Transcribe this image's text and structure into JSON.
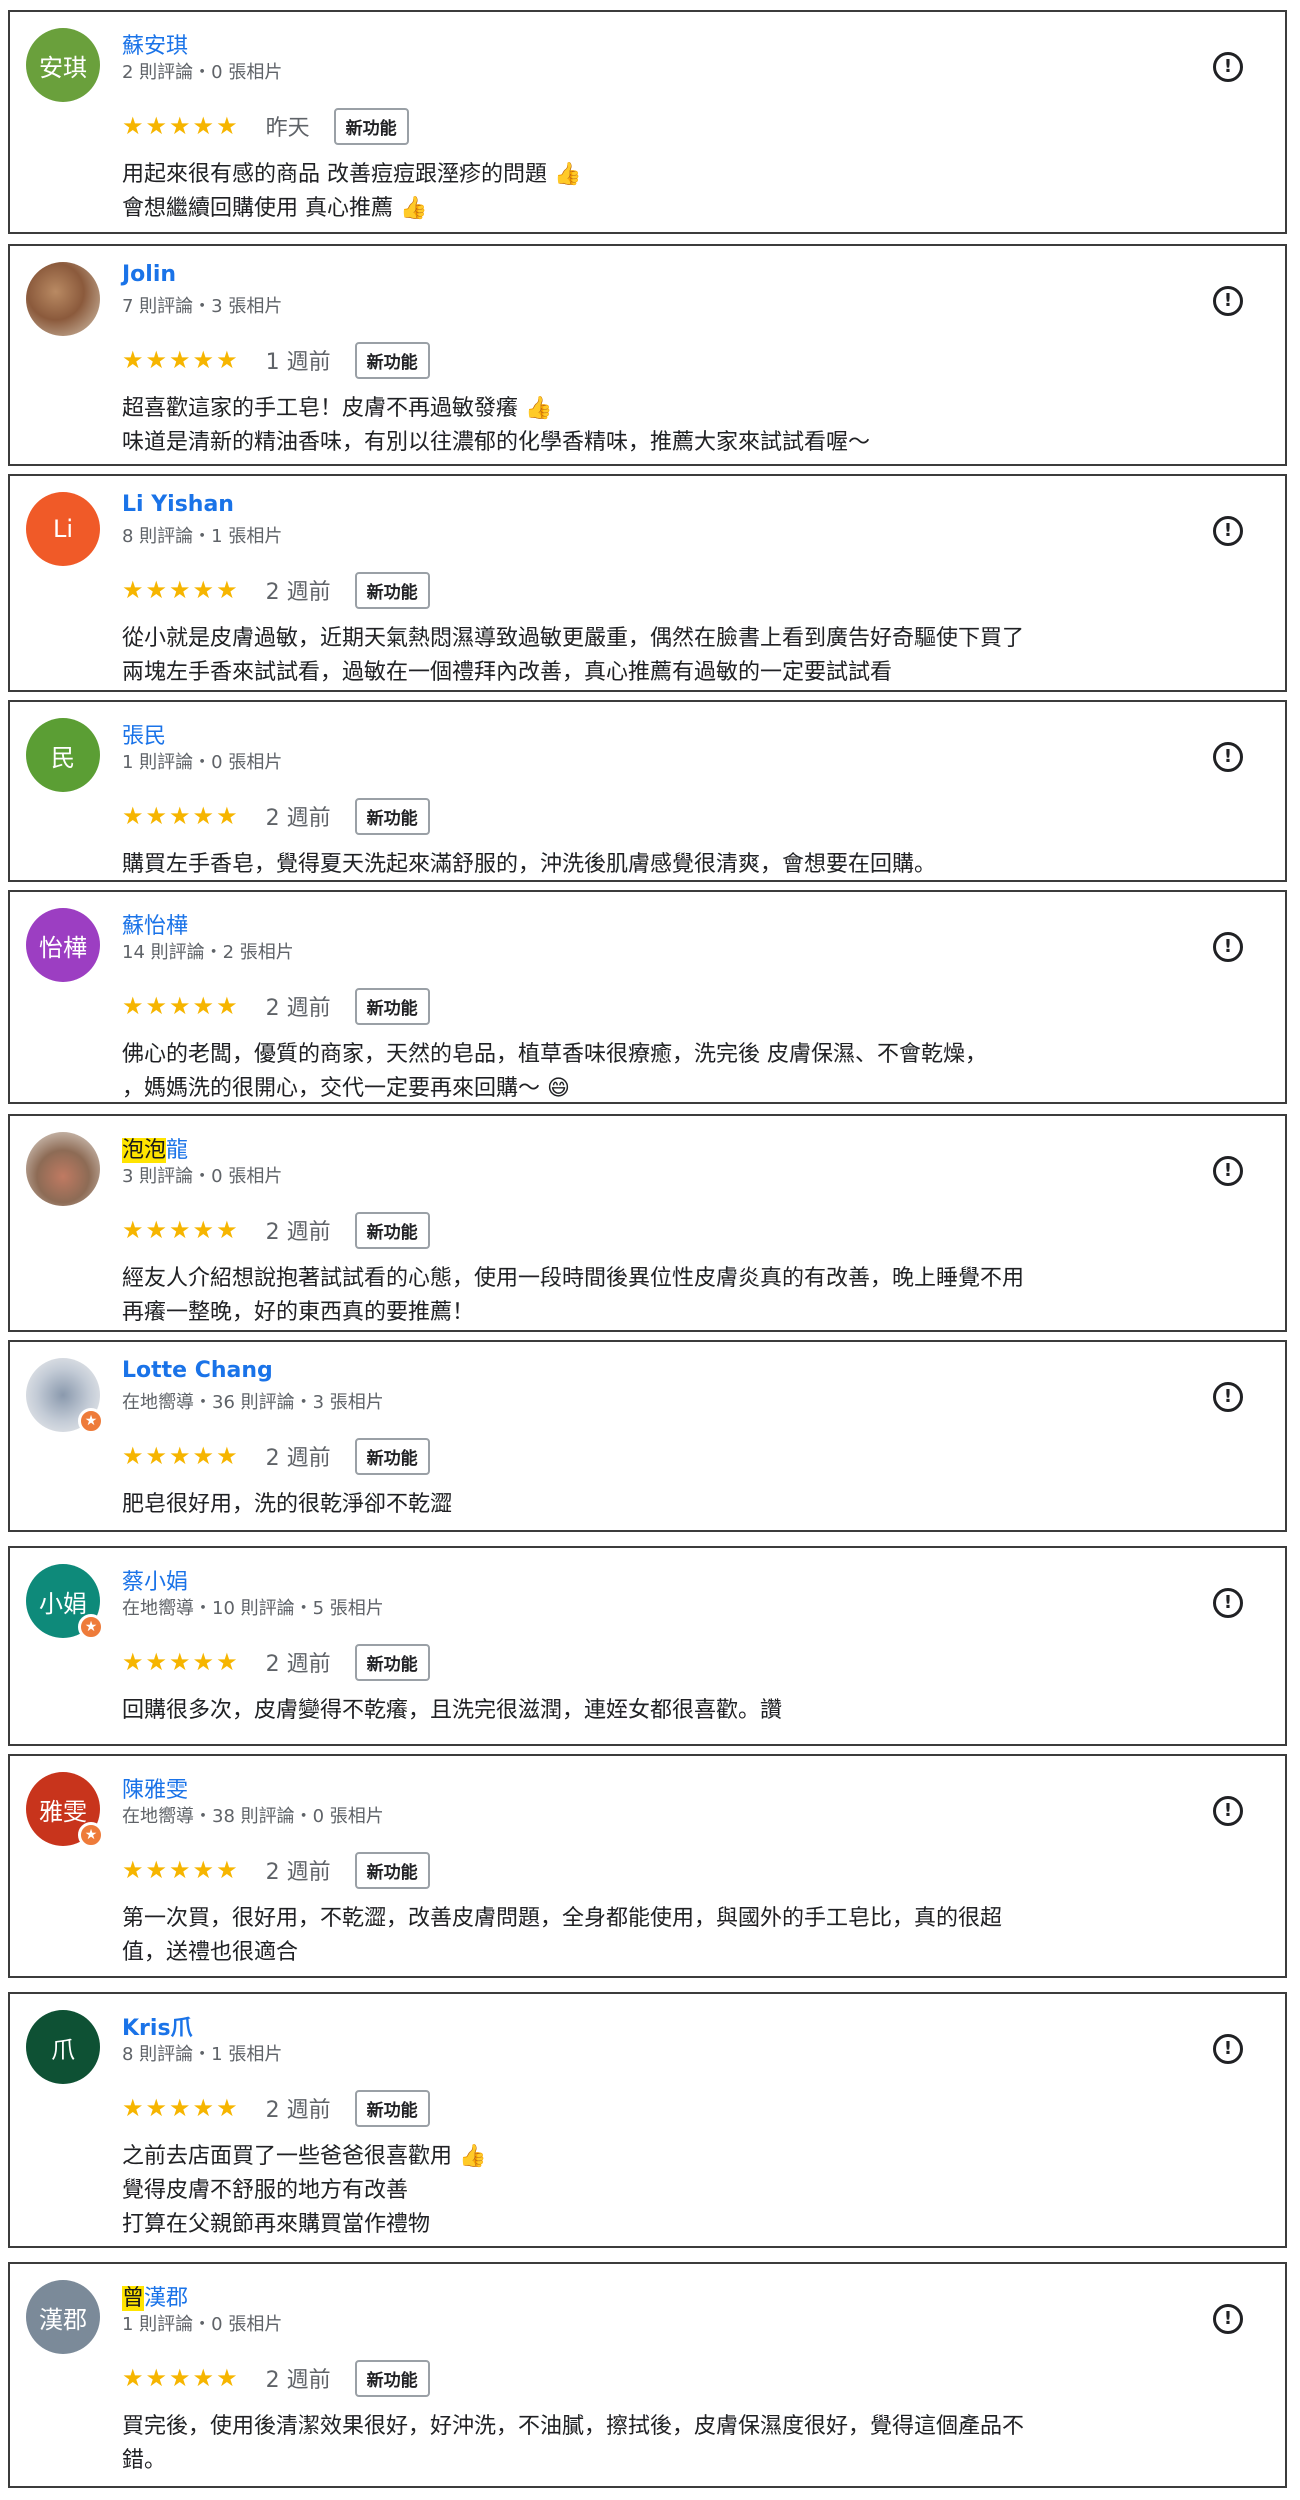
{
  "new_badge_label": "新功能",
  "stars": "★★★★★",
  "report_glyph": "!",
  "reviews": [
    {
      "avatar_text": "安琪",
      "avatar_color": "#6aa03c",
      "name": "蘇安琪",
      "name_hl": "",
      "meta": "2 則評論・0 張相片",
      "time": "昨天",
      "lines": [
        "用起來很有感的商品 改善痘痘跟溼疹的問題 👍",
        "會想繼續回購使用 真心推薦 👍"
      ]
    },
    {
      "avatar_text": "",
      "avatar_color": "#8b5a3c",
      "name": "Jolin",
      "name_hl": "",
      "meta": "7 則評論・3 張相片",
      "time": "1 週前",
      "lines": [
        "超喜歡這家的手工皂！皮膚不再過敏發癢 👍",
        "味道是清新的精油香味，有別以往濃郁的化學香精味，推薦大家來試試看喔～"
      ]
    },
    {
      "avatar_text": "Li",
      "avatar_color": "#f05a28",
      "name": "Li Yishan",
      "name_hl": "",
      "meta": "8 則評論・1 張相片",
      "time": "2 週前",
      "lines": [
        "從小就是皮膚過敏，近期天氣熱悶濕導致過敏更嚴重，偶然在臉書上看到廣告好奇驅使下買了",
        "兩塊左手香來試試看，過敏在一個禮拜內改善，真心推薦有過敏的一定要試試看"
      ]
    },
    {
      "avatar_text": "民",
      "avatar_color": "#5b9e34",
      "name": "張民",
      "name_hl": "",
      "meta": "1 則評論・0 張相片",
      "time": "2 週前",
      "lines": [
        "購買左手香皂，覺得夏天洗起來滿舒服的，沖洗後肌膚感覺很清爽，會想要在回購。"
      ]
    },
    {
      "avatar_text": "怡樺",
      "avatar_color": "#9c3ec2",
      "name": "蘇怡樺",
      "name_hl": "",
      "meta": "14 則評論・2 張相片",
      "time": "2 週前",
      "lines": [
        "佛心的老闆，優質的商家，天然的皂品，植草香味很療癒，洗完後 皮膚保濕、不會乾燥，",
        "，媽媽洗的很開心，交代一定要再來回購～ 😄"
      ]
    },
    {
      "avatar_text": "",
      "avatar_color": "#c07a62",
      "name": "龍",
      "name_hl": "泡泡",
      "meta": "3 則評論・0 張相片",
      "time": "2 週前",
      "lines": [
        "經友人介紹想說抱著試試看的心態，使用一段時間後異位性皮膚炎真的有改善，晚上睡覺不用",
        "再癢一整晚，好的東西真的要推薦！"
      ]
    },
    {
      "avatar_text": "",
      "avatar_color": "#8a99ad",
      "name": "Lotte Chang",
      "name_hl": "",
      "meta": "在地嚮導・36 則評論・3 張相片",
      "time": "2 週前",
      "lines": [
        "肥皂很好用，洗的很乾淨卻不乾澀"
      ]
    },
    {
      "avatar_text": "小娟",
      "avatar_color": "#0e8a7a",
      "name": "蔡小娟",
      "name_hl": "",
      "meta": "在地嚮導・10 則評論・5 張相片",
      "time": "2 週前",
      "lines": [
        "回購很多次，皮膚變得不乾癢，且洗完很滋潤，連姪女都很喜歡。讚"
      ]
    },
    {
      "avatar_text": "雅雯",
      "avatar_color": "#c8341c",
      "name": "陳雅雯",
      "name_hl": "",
      "meta": "在地嚮導・38 則評論・0 張相片",
      "time": "2 週前",
      "lines": [
        "第一次買，很好用，不乾澀，改善皮膚問題，全身都能使用，與國外的手工皂比，真的很超",
        "值，送禮也很適合"
      ]
    },
    {
      "avatar_text": "爪",
      "avatar_color": "#0e5134",
      "name": "Kris爪",
      "name_hl": "",
      "meta": "8 則評論・1 張相片",
      "time": "2 週前",
      "lines": [
        "之前去店面買了一些爸爸很喜歡用 👍",
        "覺得皮膚不舒服的地方有改善",
        "打算在父親節再來購買當作禮物"
      ]
    },
    {
      "avatar_text": "漢郡",
      "avatar_color": "#7b8a99",
      "name": "漢郡",
      "name_hl": "曾",
      "meta": "1 則評論・0 張相片",
      "time": "2 週前",
      "lines": [
        "買完後，使用後清潔效果很好，好沖洗，不油膩，擦拭後，皮膚保濕度很好，覺得這個產品不",
        "錯。"
      ]
    }
  ]
}
